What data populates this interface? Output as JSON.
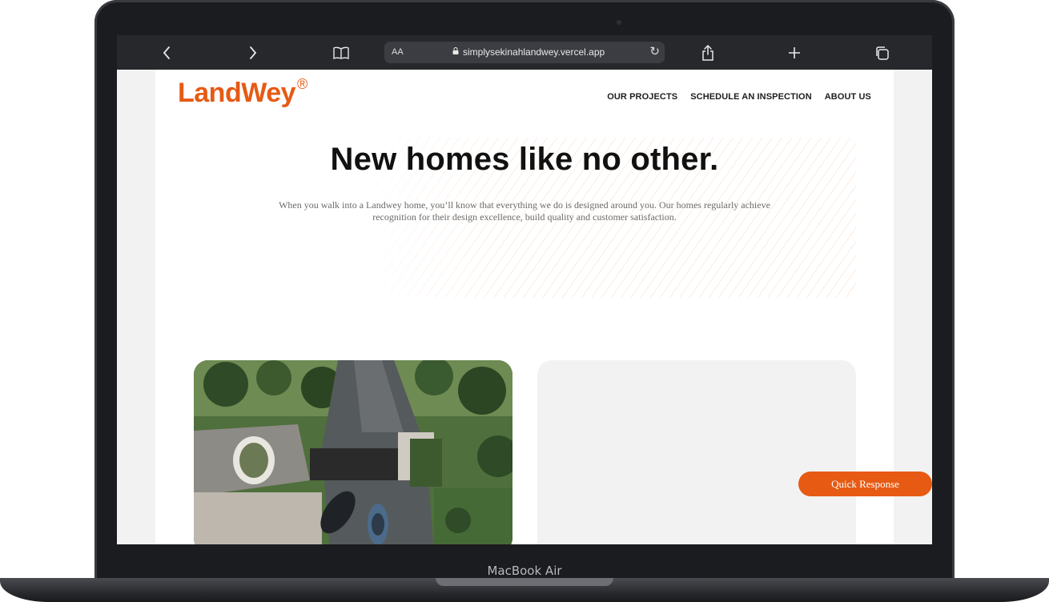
{
  "device": {
    "label": "MacBook Air"
  },
  "browser": {
    "text_size_label": "AA",
    "url": "simplysekinahlandwey.vercel.app",
    "icons": [
      "chevron-left-icon",
      "chevron-right-icon",
      "book-icon",
      "lock-icon",
      "reload-icon",
      "share-icon",
      "plus-icon",
      "tabs-icon"
    ]
  },
  "site": {
    "logo_text": "LandWey",
    "logo_mark": "®",
    "nav": [
      "OUR PROJECTS",
      "SCHEDULE AN INSPECTION",
      "ABOUT US"
    ],
    "hero_title": "New homes like no other.",
    "hero_text": "When you walk into a Landwey home, you’ll know that everything we do is designed around you. Our homes regularly achieve recognition for their design excellence, build quality and customer satisfaction.",
    "quick_response": "Quick Response"
  },
  "colors": {
    "brand": "#e65a14",
    "toolbar": "#26282c",
    "card_grey": "#f2f2f2"
  }
}
